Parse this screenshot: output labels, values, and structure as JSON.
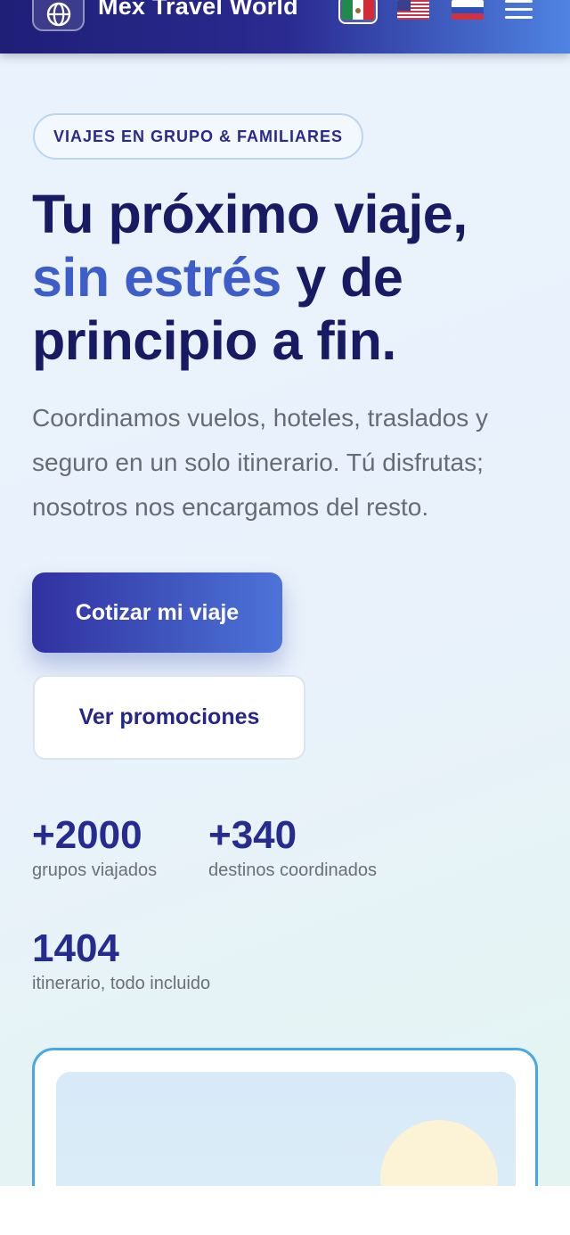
{
  "header": {
    "brand": "Mex Travel World",
    "logo_icon": "globe-icon",
    "languages": [
      {
        "name": "mexico-flag-icon",
        "active": true
      },
      {
        "name": "usa-flag-icon",
        "active": false
      },
      {
        "name": "russia-flag-icon",
        "active": false
      }
    ],
    "menu_icon": "hamburger-menu-icon"
  },
  "hero": {
    "badge": "VIAJES EN GRUPO & FAMILIARES",
    "title_line1": "Tu próximo viaje,",
    "title_accent": "sin estrés",
    "title_line2_rest": " y de",
    "title_line3": "principio a fin.",
    "subtitle": "Coordinamos vuelos, hoteles, traslados y seguro en un solo itinerario. Tú disfrutas; nosotros nos encargamos del resto.",
    "primary_cta": "Cotizar mi viaje",
    "secondary_cta": "Ver promociones"
  },
  "stats": [
    {
      "value": "+2000",
      "label": "grupos viajados"
    },
    {
      "value": "+340",
      "label": "destinos coordinados"
    },
    {
      "value": "1404",
      "label": "itinerario, todo incluido"
    }
  ],
  "colors": {
    "header_start": "#1f1f78",
    "header_end": "#4f84e3",
    "title": "#181a63",
    "accent": "#3d5ec8",
    "card_border": "#4aa7e6"
  }
}
